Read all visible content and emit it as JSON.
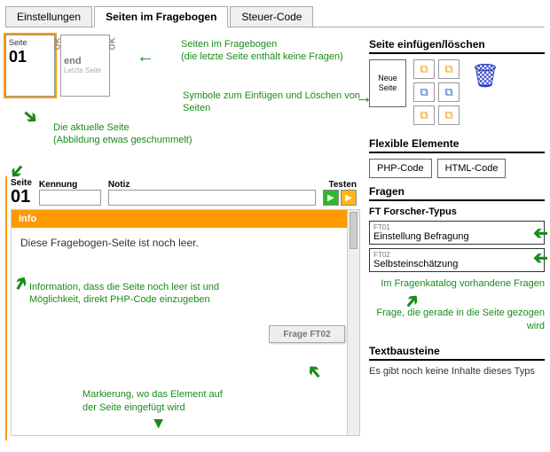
{
  "tabs": {
    "settings": "Einstellungen",
    "pages": "Seiten im Fragebogen",
    "tax": "Steuer-Code"
  },
  "thumbs": {
    "page_label": "Seite",
    "page_num": "01",
    "ok": "OK",
    "end_label": "end",
    "end_sub": "Letzte Seite"
  },
  "annot": {
    "pages_in_survey": "Seiten im Fragebogen\n(die letzte Seite enthält keine Fragen)",
    "symbols": "Symbole zum Einfügen und Löschen von Seiten",
    "current_page": "Die aktuelle Seite\n(Abbildung etwas geschummelt)",
    "info_empty": "Information, dass die Seite noch leer ist und Möglichkeit, direkt PHP-Code einzugeben",
    "insert_marker": "Markierung, wo das Element auf der Seite eingefügt wird",
    "questions_available": "Im Fragenkatalog vorhandene Fragen",
    "question_dragged": "Frage, die gerade in die Seite gezogen wird"
  },
  "editor": {
    "page_label": "Seite",
    "page_num": "01",
    "id_label": "Kennung",
    "note_label": "Notiz",
    "test_label": "Testen",
    "id_value": "",
    "note_value": ""
  },
  "info": {
    "title": "Info",
    "body": "Diese Fragebogen-Seite ist noch leer.",
    "drop_label": "Frage FT02"
  },
  "right": {
    "insert_heading": "Seite einfügen/löschen",
    "new_page": "Neue Seite",
    "flex_heading": "Flexible Elemente",
    "php": "PHP-Code",
    "html": "HTML-Code",
    "q_heading": "Fragen",
    "q_group": "FT Forscher-Typus",
    "q1_code": "FT01",
    "q1_label": "Einstellung Befragung",
    "q2_code": "FT02",
    "q2_label": "Selbsteinschätzung",
    "text_heading": "Textbausteine",
    "text_empty": "Es gibt noch keine Inhalte dieses Typs"
  }
}
